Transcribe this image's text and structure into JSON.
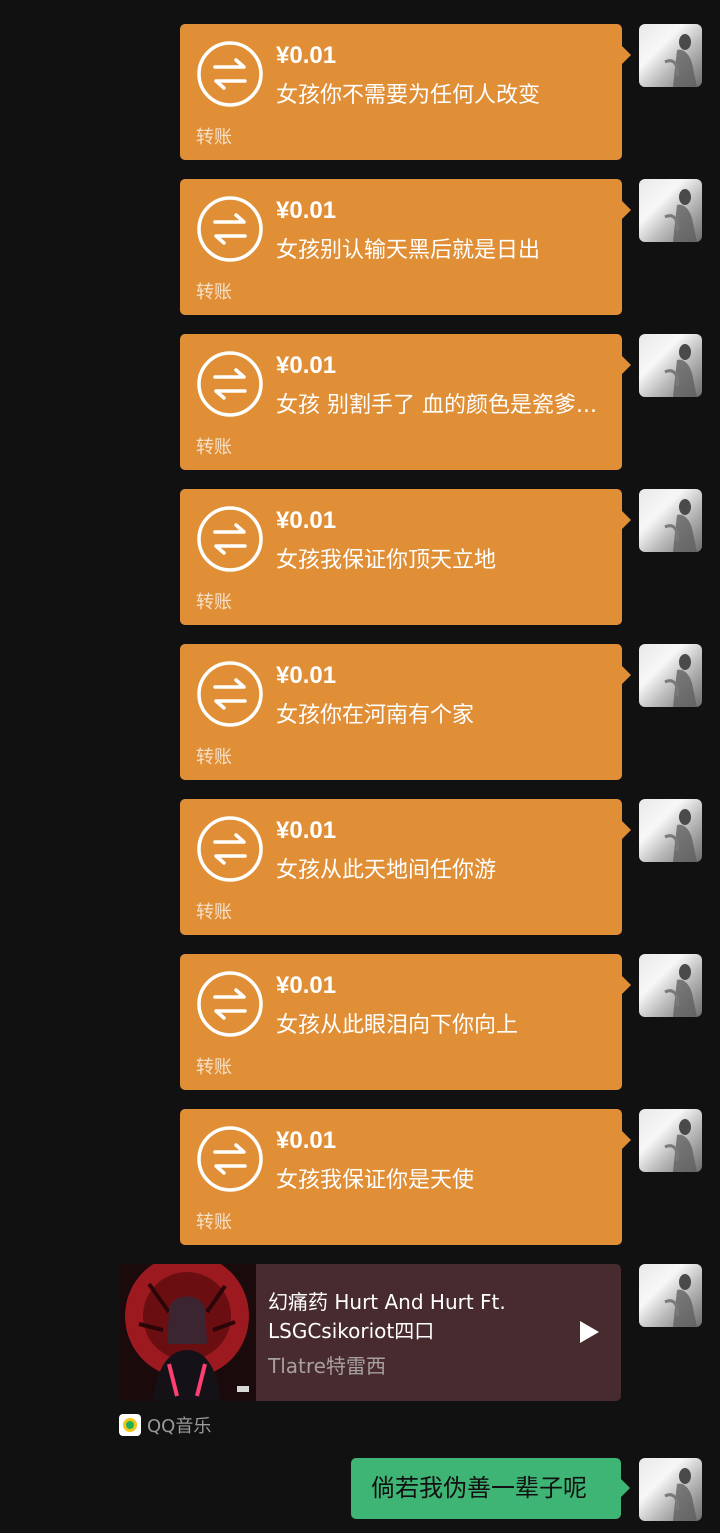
{
  "transfers": [
    {
      "amount": "¥0.01",
      "note": "女孩你不需要为任何人改变",
      "label": "转账"
    },
    {
      "amount": "¥0.01",
      "note": "女孩别认输天黑后就是日出",
      "label": "转账"
    },
    {
      "amount": "¥0.01",
      "note": "女孩 别割手了 血的颜色是瓷爹...",
      "label": "转账"
    },
    {
      "amount": "¥0.01",
      "note": "女孩我保证你顶天立地",
      "label": "转账"
    },
    {
      "amount": "¥0.01",
      "note": "女孩你在河南有个家",
      "label": "转账"
    },
    {
      "amount": "¥0.01",
      "note": "女孩从此天地间任你游",
      "label": "转账"
    },
    {
      "amount": "¥0.01",
      "note": "女孩从此眼泪向下你向上",
      "label": "转账"
    },
    {
      "amount": "¥0.01",
      "note": "女孩我保证你是天使",
      "label": "转账"
    }
  ],
  "music": {
    "title": "幻痛药 Hurt And Hurt Ft. LSGCsikoriot四口",
    "artist": "Tlatre特雷西",
    "source_label": "QQ音乐",
    "play_icon": "play-icon"
  },
  "text_message": "倘若我伪善一辈子呢",
  "colors": {
    "background": "#111111",
    "transfer_bubble": "#e08f36",
    "music_card": "#482b2e",
    "text_bubble": "#3eb575"
  }
}
